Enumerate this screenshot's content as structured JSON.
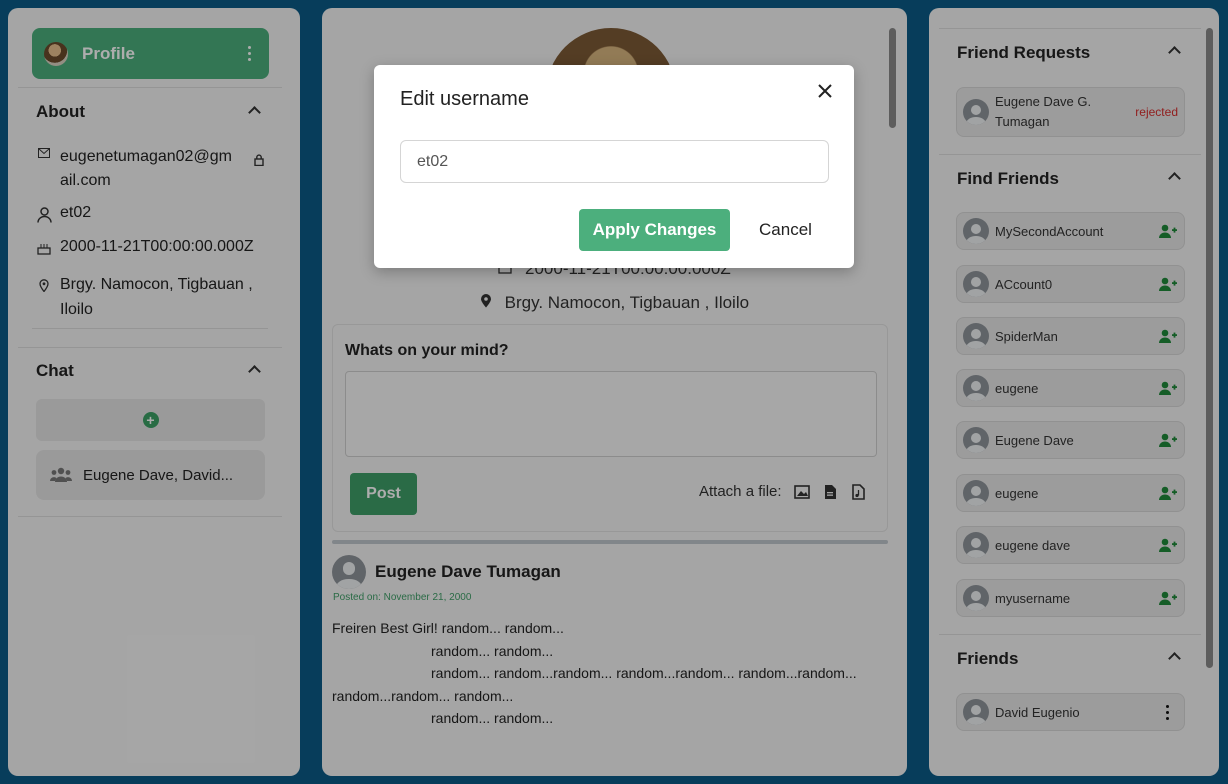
{
  "left": {
    "profile_label": "Profile",
    "about_title": "About",
    "email": "eugenetumagan02@gm ail.com",
    "email_line1": "eugenetumagan02@gm",
    "email_line2": "ail.com",
    "username": "et02",
    "birthdate": "2000-11-21T00:00:00.000Z",
    "address_line1": "Brgy. Namocon, Tigbauan ,",
    "address_line2": "Iloilo",
    "chat_title": "Chat",
    "chats": [
      "Eugene Dave, David..."
    ]
  },
  "center": {
    "birthdate": "2000-11-21T00:00:00.000Z",
    "address": "Brgy. Namocon, Tigbauan , Iloilo",
    "composer_prompt": "Whats on your mind?",
    "post_button": "Post",
    "attach_label": "Attach a file:",
    "post": {
      "author": "Eugene Dave Tumagan",
      "date": "Posted on: November 21, 2000",
      "lines": [
        "Freiren Best Girl! random... random...",
        "random... random...",
        "random... random...random... random...random... random...random...",
        "random...random... random...",
        "random... random..."
      ]
    }
  },
  "right": {
    "friend_requests_title": "Friend Requests",
    "friend_requests": [
      {
        "name_line1": "Eugene Dave G.",
        "name_line2": "Tumagan",
        "status": "rejected"
      }
    ],
    "find_friends_title": "Find Friends",
    "find_friends": [
      "MySecondAccount",
      "ACcount0",
      "SpiderMan",
      "eugene",
      "Eugene Dave",
      "eugene",
      "eugene dave",
      "myusername"
    ],
    "friends_title": "Friends",
    "friends": [
      "David Eugenio"
    ]
  },
  "modal": {
    "title": "Edit username",
    "input_value": "et02",
    "apply_label": "Apply Changes",
    "cancel_label": "Cancel"
  },
  "colors": {
    "accent": "#4caf7d",
    "background": "#0b5a86",
    "rejected": "#d62f2f"
  }
}
